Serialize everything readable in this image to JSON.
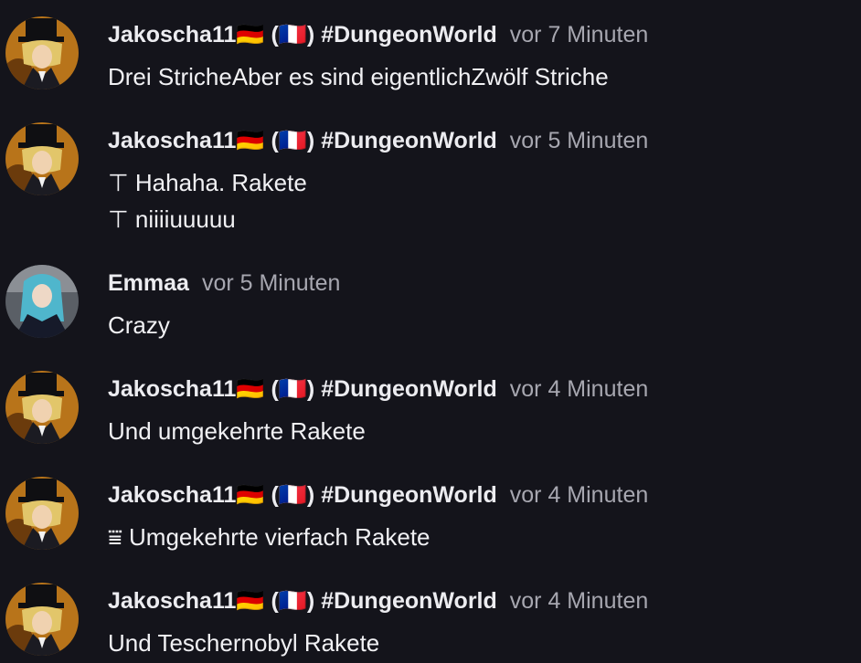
{
  "messages": [
    {
      "username": "Jakoscha11🇩🇪 (🇫🇷) #DungeonWorld",
      "time": "vor 7 Minuten",
      "lines": [
        "Drei StricheAber es sind eigentlichZwölf Striche"
      ]
    },
    {
      "username": "Jakoscha11🇩🇪 (🇫🇷) #DungeonWorld",
      "time": "vor 5 Minuten",
      "lines": [
        "⊤ Hahaha. Rakete",
        "⊤ niiiiuuuuu"
      ]
    },
    {
      "username": "Emmaa",
      "time": "vor 5 Minuten",
      "lines": [
        "Crazy"
      ]
    },
    {
      "username": "Jakoscha11🇩🇪 (🇫🇷) #DungeonWorld",
      "time": "vor 4 Minuten",
      "lines": [
        "Und umgekehrte Rakete "
      ]
    },
    {
      "username": "Jakoscha11🇩🇪 (🇫🇷) #DungeonWorld",
      "time": "vor 4 Minuten",
      "lines": [
        "⩸ Umgekehrte vierfach Rakete"
      ]
    },
    {
      "username": "Jakoscha11🇩🇪 (🇫🇷) #DungeonWorld",
      "time": "vor 4 Minuten",
      "lines": [
        " Und Teschernobyl Rakete"
      ]
    }
  ],
  "avatars": {
    "jakoscha": "blonde-character-top-hat-icon",
    "emmaa": "blue-haired-character-icon"
  }
}
